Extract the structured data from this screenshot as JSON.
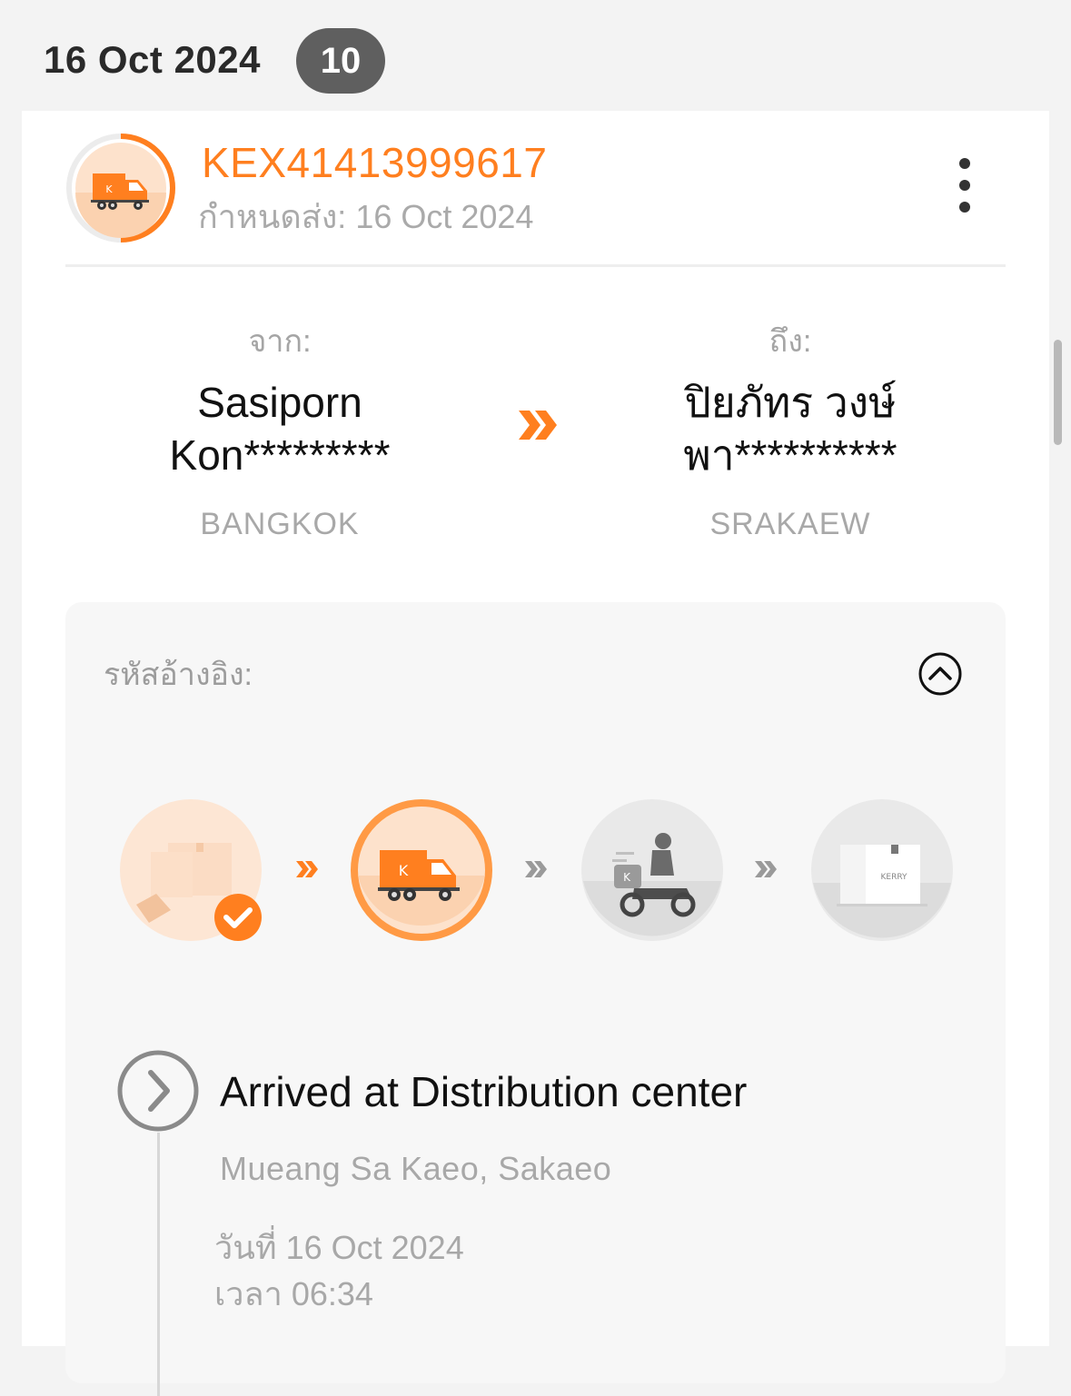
{
  "group": {
    "date": "16 Oct 2024",
    "count": "10"
  },
  "shipment": {
    "tracking_number": "KEX41413999617",
    "due_label": "กำหนดส่ง:",
    "due_date": "16 Oct 2024",
    "from": {
      "label": "จาก:",
      "name_line1": "Sasiporn",
      "name_line2": "Kon*********",
      "city": "BANGKOK"
    },
    "to": {
      "label": "ถึง:",
      "name_line1": "ปิยภัทร วงษ์",
      "name_line2": "พา**********",
      "city": "SRAKAEW"
    },
    "reference_label": "รหัสอ้างอิง:",
    "progress": {
      "steps": [
        {
          "icon": "package-pickup-icon",
          "state": "done"
        },
        {
          "icon": "delivery-truck-icon",
          "state": "current"
        },
        {
          "icon": "courier-scooter-icon",
          "state": "pending"
        },
        {
          "icon": "delivered-box-icon",
          "state": "pending"
        }
      ]
    },
    "latest_status": {
      "title": "Arrived at Distribution center",
      "location": "Mueang Sa Kaeo, Sakaeo",
      "date_label": "วันที่",
      "date": "16 Oct 2024",
      "time_label": "เวลา",
      "time": "06:34"
    }
  },
  "colors": {
    "accent": "#ff7f1f",
    "badge_bg": "#5f5f5f",
    "muted_text": "#a8a8a8",
    "panel_bg": "#f7f7f7"
  }
}
